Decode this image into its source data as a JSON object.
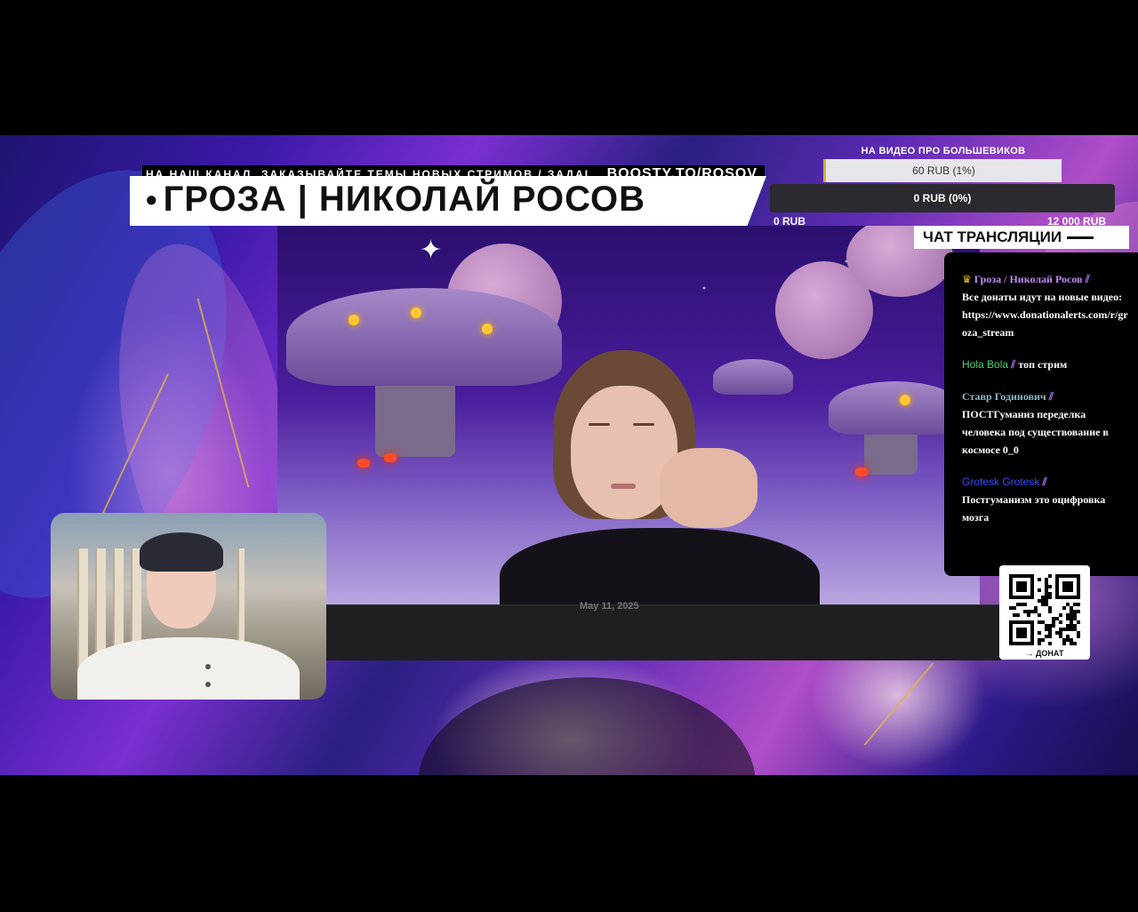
{
  "ticker": {
    "text": "НА НАШ КАНАЛ, ЗАКАЗЫВАЙТЕ ТЕМЫ НОВЫХ СТРИМОВ / ЗАДАІ",
    "boosty": "BOOSTY.TO/ROSOV"
  },
  "title": {
    "bullet": "•",
    "text": "ГРОЗА | НИКОЛАЙ РОСОВ"
  },
  "goal": {
    "title": "НА ВИДЕО ПРО БОЛЬШЕВИКОВ",
    "progress_label": "60 RUB (1%)",
    "progress_fraction": 0.01,
    "second_label": "0 RUB (0%)",
    "min_label": "0 RUB",
    "max_label": "12 000 RUB",
    "accent_color": "#d4b02a"
  },
  "video": {
    "date_text": "May 11, 2025"
  },
  "chat": {
    "header": "ЧАТ ТРАНСЛЯЦИИ",
    "messages": [
      {
        "author": "Гроза / Николай Росов",
        "author_color": "#c38bf5",
        "badge": "crown-icon",
        "text": "Все донаты идут на новые видео:",
        "link": "https://www.donationalerts.com/r/groza_stream"
      },
      {
        "author": "Hola Bola",
        "author_color": "#4fd36a",
        "text": "топ стрим"
      },
      {
        "author": "Ставр Годинович",
        "author_color": "#8fb8c8",
        "text": "ПОСТГуманиз переделка человека под существование в космосе 0_0"
      },
      {
        "author": "Grotesk Grotesk",
        "author_color": "#3a4bff",
        "text": "Постгуманизм это оцифровка мозга"
      }
    ]
  },
  "qr": {
    "label": "→ ДОНАТ"
  }
}
